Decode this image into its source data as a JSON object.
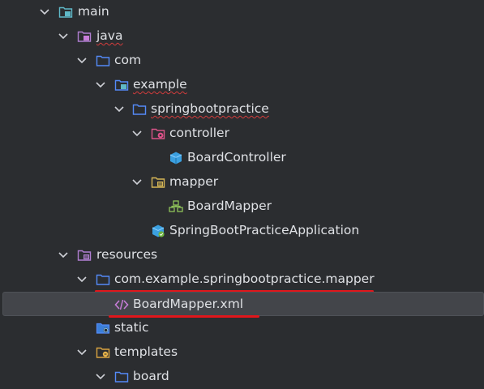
{
  "tree": {
    "items": [
      {
        "label": "main",
        "icon": "source-root-folder-icon",
        "expanded": true
      },
      {
        "label": "java",
        "icon": "java-source-folder-icon",
        "expanded": true
      },
      {
        "label": "com",
        "icon": "package-folder-icon",
        "expanded": true
      },
      {
        "label": "example",
        "icon": "package-folder-icon",
        "expanded": true
      },
      {
        "label": "springbootpractice",
        "icon": "package-folder-icon",
        "expanded": true
      },
      {
        "label": "controller",
        "icon": "controller-folder-icon",
        "expanded": true
      },
      {
        "label": "BoardController",
        "icon": "spring-bean-class-icon"
      },
      {
        "label": "mapper",
        "icon": "mapper-folder-icon",
        "expanded": true
      },
      {
        "label": "BoardMapper",
        "icon": "mybatis-mapper-interface-icon"
      },
      {
        "label": "SpringBootPracticeApplication",
        "icon": "spring-boot-application-icon"
      },
      {
        "label": "resources",
        "icon": "resources-folder-icon",
        "expanded": true
      },
      {
        "label": "com.example.springbootpractice.mapper",
        "icon": "folder-icon",
        "expanded": true
      },
      {
        "label": "BoardMapper.xml",
        "icon": "xml-file-icon",
        "selected": true
      },
      {
        "label": "static",
        "icon": "static-folder-icon"
      },
      {
        "label": "templates",
        "icon": "templates-folder-icon",
        "expanded": true
      },
      {
        "label": "board",
        "icon": "folder-icon",
        "expanded": true
      }
    ]
  },
  "colors": {
    "background": "#2b2d30",
    "selection": "#43454a",
    "text": "#dfe1e5",
    "folder": "#548af7",
    "annotation_red": "#e0161b",
    "spell_underline": "#d23c3c"
  }
}
